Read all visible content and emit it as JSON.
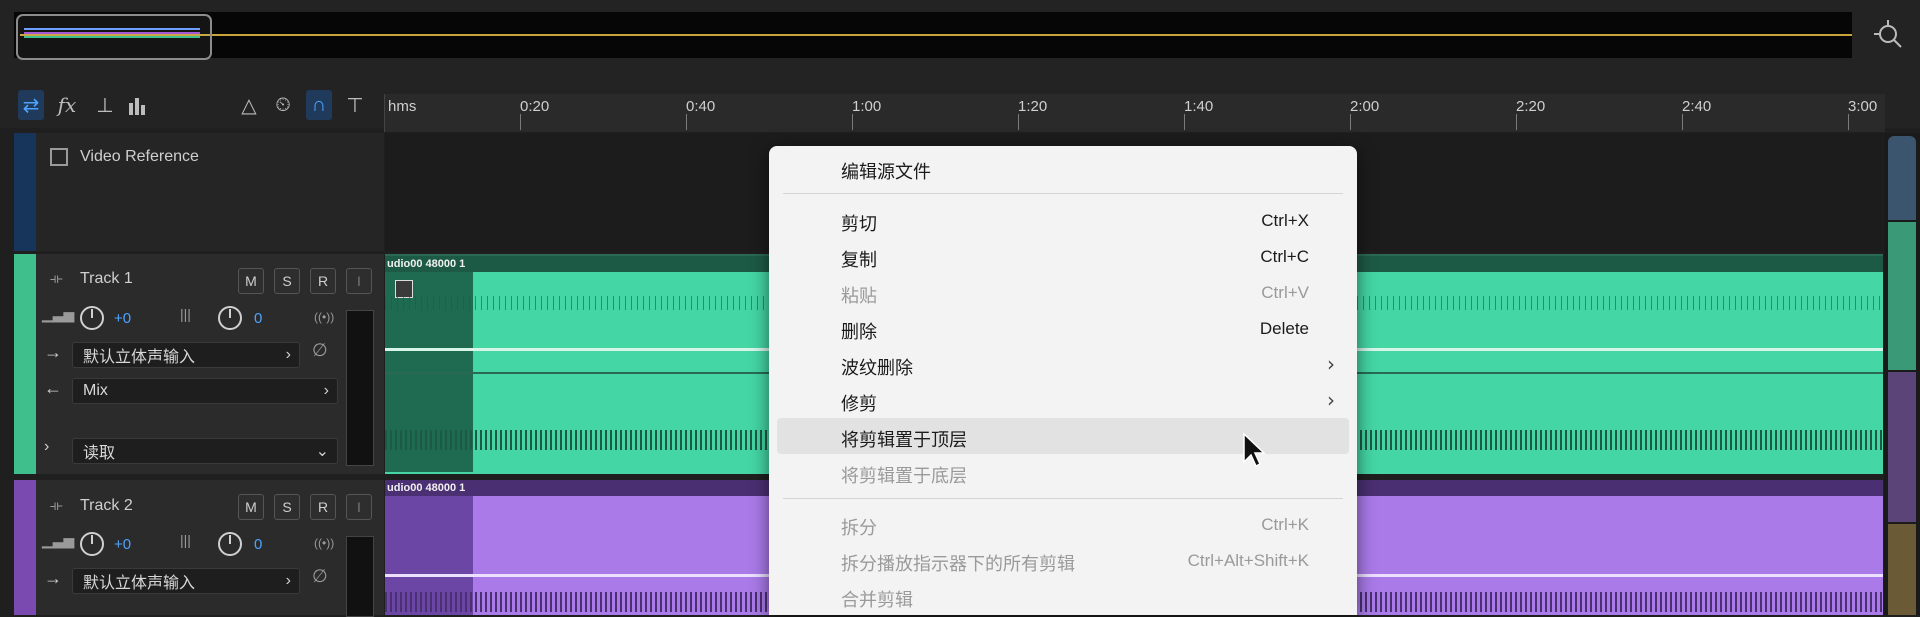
{
  "overview": {
    "accent": "#c8a23a"
  },
  "toolbar": {
    "left_icons": [
      "swap-arrows-icon",
      "fx-icon",
      "send-icon",
      "meter-bars-icon"
    ],
    "right_icons": [
      "metronome-icon",
      "time-stretch-icon",
      "snap-magnet-icon",
      "marker-pin-icon"
    ],
    "fx_label": "fx"
  },
  "ruler": {
    "labels": [
      "hms",
      "0:20",
      "0:40",
      "1:00",
      "1:20",
      "1:40",
      "2:00",
      "2:20",
      "2:40",
      "3:00"
    ]
  },
  "video_track": {
    "name": "Video Reference"
  },
  "tracks": [
    {
      "name": "Track 1",
      "color": "#3fbf8c",
      "buttons": [
        "M",
        "S",
        "R"
      ],
      "volume": "+0",
      "pan": "0",
      "input": "默认立体声输入",
      "output": "Mix",
      "automation": "读取",
      "clip_title": "udio00 48000 1",
      "clip_color": "#44d6a4"
    },
    {
      "name": "Track 2",
      "color": "#7a4ab0",
      "buttons": [
        "M",
        "S",
        "R"
      ],
      "volume": "+0",
      "pan": "0",
      "input": "默认立体声输入",
      "clip_title": "udio00 48000 1",
      "clip_color": "#a97ae8"
    }
  ],
  "context_menu": {
    "items": [
      {
        "label": "编辑源文件",
        "shortcut": "",
        "disabled": false
      },
      {
        "label": "剪切",
        "shortcut": "Ctrl+X",
        "disabled": false
      },
      {
        "label": "复制",
        "shortcut": "Ctrl+C",
        "disabled": false
      },
      {
        "label": "粘贴",
        "shortcut": "Ctrl+V",
        "disabled": true
      },
      {
        "label": "删除",
        "shortcut": "Delete",
        "disabled": false
      },
      {
        "label": "波纹删除",
        "shortcut": "",
        "disabled": false,
        "submenu": true
      },
      {
        "label": "修剪",
        "shortcut": "",
        "disabled": false,
        "submenu": true
      },
      {
        "label": "将剪辑置于顶层",
        "shortcut": "",
        "disabled": false,
        "hover": true
      },
      {
        "label": "将剪辑置于底层",
        "shortcut": "",
        "disabled": true
      },
      {
        "label": "拆分",
        "shortcut": "Ctrl+K",
        "disabled": true
      },
      {
        "label": "拆分播放指示器下的所有剪辑",
        "shortcut": "Ctrl+Alt+Shift+K",
        "disabled": true
      },
      {
        "label": "合并剪辑",
        "shortcut": "",
        "disabled": true
      }
    ]
  }
}
